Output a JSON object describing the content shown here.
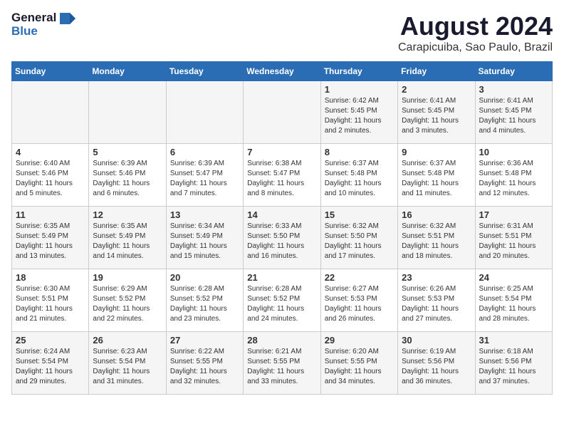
{
  "logo": {
    "line1": "General",
    "line2": "Blue"
  },
  "title": "August 2024",
  "subtitle": "Carapicuiba, Sao Paulo, Brazil",
  "days_of_week": [
    "Sunday",
    "Monday",
    "Tuesday",
    "Wednesday",
    "Thursday",
    "Friday",
    "Saturday"
  ],
  "weeks": [
    [
      {
        "day": "",
        "sunrise": "",
        "sunset": "",
        "daylight": ""
      },
      {
        "day": "",
        "sunrise": "",
        "sunset": "",
        "daylight": ""
      },
      {
        "day": "",
        "sunrise": "",
        "sunset": "",
        "daylight": ""
      },
      {
        "day": "",
        "sunrise": "",
        "sunset": "",
        "daylight": ""
      },
      {
        "day": "1",
        "sunrise": "Sunrise: 6:42 AM",
        "sunset": "Sunset: 5:45 PM",
        "daylight": "Daylight: 11 hours and 2 minutes."
      },
      {
        "day": "2",
        "sunrise": "Sunrise: 6:41 AM",
        "sunset": "Sunset: 5:45 PM",
        "daylight": "Daylight: 11 hours and 3 minutes."
      },
      {
        "day": "3",
        "sunrise": "Sunrise: 6:41 AM",
        "sunset": "Sunset: 5:45 PM",
        "daylight": "Daylight: 11 hours and 4 minutes."
      }
    ],
    [
      {
        "day": "4",
        "sunrise": "Sunrise: 6:40 AM",
        "sunset": "Sunset: 5:46 PM",
        "daylight": "Daylight: 11 hours and 5 minutes."
      },
      {
        "day": "5",
        "sunrise": "Sunrise: 6:39 AM",
        "sunset": "Sunset: 5:46 PM",
        "daylight": "Daylight: 11 hours and 6 minutes."
      },
      {
        "day": "6",
        "sunrise": "Sunrise: 6:39 AM",
        "sunset": "Sunset: 5:47 PM",
        "daylight": "Daylight: 11 hours and 7 minutes."
      },
      {
        "day": "7",
        "sunrise": "Sunrise: 6:38 AM",
        "sunset": "Sunset: 5:47 PM",
        "daylight": "Daylight: 11 hours and 8 minutes."
      },
      {
        "day": "8",
        "sunrise": "Sunrise: 6:37 AM",
        "sunset": "Sunset: 5:48 PM",
        "daylight": "Daylight: 11 hours and 10 minutes."
      },
      {
        "day": "9",
        "sunrise": "Sunrise: 6:37 AM",
        "sunset": "Sunset: 5:48 PM",
        "daylight": "Daylight: 11 hours and 11 minutes."
      },
      {
        "day": "10",
        "sunrise": "Sunrise: 6:36 AM",
        "sunset": "Sunset: 5:48 PM",
        "daylight": "Daylight: 11 hours and 12 minutes."
      }
    ],
    [
      {
        "day": "11",
        "sunrise": "Sunrise: 6:35 AM",
        "sunset": "Sunset: 5:49 PM",
        "daylight": "Daylight: 11 hours and 13 minutes."
      },
      {
        "day": "12",
        "sunrise": "Sunrise: 6:35 AM",
        "sunset": "Sunset: 5:49 PM",
        "daylight": "Daylight: 11 hours and 14 minutes."
      },
      {
        "day": "13",
        "sunrise": "Sunrise: 6:34 AM",
        "sunset": "Sunset: 5:49 PM",
        "daylight": "Daylight: 11 hours and 15 minutes."
      },
      {
        "day": "14",
        "sunrise": "Sunrise: 6:33 AM",
        "sunset": "Sunset: 5:50 PM",
        "daylight": "Daylight: 11 hours and 16 minutes."
      },
      {
        "day": "15",
        "sunrise": "Sunrise: 6:32 AM",
        "sunset": "Sunset: 5:50 PM",
        "daylight": "Daylight: 11 hours and 17 minutes."
      },
      {
        "day": "16",
        "sunrise": "Sunrise: 6:32 AM",
        "sunset": "Sunset: 5:51 PM",
        "daylight": "Daylight: 11 hours and 18 minutes."
      },
      {
        "day": "17",
        "sunrise": "Sunrise: 6:31 AM",
        "sunset": "Sunset: 5:51 PM",
        "daylight": "Daylight: 11 hours and 20 minutes."
      }
    ],
    [
      {
        "day": "18",
        "sunrise": "Sunrise: 6:30 AM",
        "sunset": "Sunset: 5:51 PM",
        "daylight": "Daylight: 11 hours and 21 minutes."
      },
      {
        "day": "19",
        "sunrise": "Sunrise: 6:29 AM",
        "sunset": "Sunset: 5:52 PM",
        "daylight": "Daylight: 11 hours and 22 minutes."
      },
      {
        "day": "20",
        "sunrise": "Sunrise: 6:28 AM",
        "sunset": "Sunset: 5:52 PM",
        "daylight": "Daylight: 11 hours and 23 minutes."
      },
      {
        "day": "21",
        "sunrise": "Sunrise: 6:28 AM",
        "sunset": "Sunset: 5:52 PM",
        "daylight": "Daylight: 11 hours and 24 minutes."
      },
      {
        "day": "22",
        "sunrise": "Sunrise: 6:27 AM",
        "sunset": "Sunset: 5:53 PM",
        "daylight": "Daylight: 11 hours and 26 minutes."
      },
      {
        "day": "23",
        "sunrise": "Sunrise: 6:26 AM",
        "sunset": "Sunset: 5:53 PM",
        "daylight": "Daylight: 11 hours and 27 minutes."
      },
      {
        "day": "24",
        "sunrise": "Sunrise: 6:25 AM",
        "sunset": "Sunset: 5:54 PM",
        "daylight": "Daylight: 11 hours and 28 minutes."
      }
    ],
    [
      {
        "day": "25",
        "sunrise": "Sunrise: 6:24 AM",
        "sunset": "Sunset: 5:54 PM",
        "daylight": "Daylight: 11 hours and 29 minutes."
      },
      {
        "day": "26",
        "sunrise": "Sunrise: 6:23 AM",
        "sunset": "Sunset: 5:54 PM",
        "daylight": "Daylight: 11 hours and 31 minutes."
      },
      {
        "day": "27",
        "sunrise": "Sunrise: 6:22 AM",
        "sunset": "Sunset: 5:55 PM",
        "daylight": "Daylight: 11 hours and 32 minutes."
      },
      {
        "day": "28",
        "sunrise": "Sunrise: 6:21 AM",
        "sunset": "Sunset: 5:55 PM",
        "daylight": "Daylight: 11 hours and 33 minutes."
      },
      {
        "day": "29",
        "sunrise": "Sunrise: 6:20 AM",
        "sunset": "Sunset: 5:55 PM",
        "daylight": "Daylight: 11 hours and 34 minutes."
      },
      {
        "day": "30",
        "sunrise": "Sunrise: 6:19 AM",
        "sunset": "Sunset: 5:56 PM",
        "daylight": "Daylight: 11 hours and 36 minutes."
      },
      {
        "day": "31",
        "sunrise": "Sunrise: 6:18 AM",
        "sunset": "Sunset: 5:56 PM",
        "daylight": "Daylight: 11 hours and 37 minutes."
      }
    ]
  ]
}
